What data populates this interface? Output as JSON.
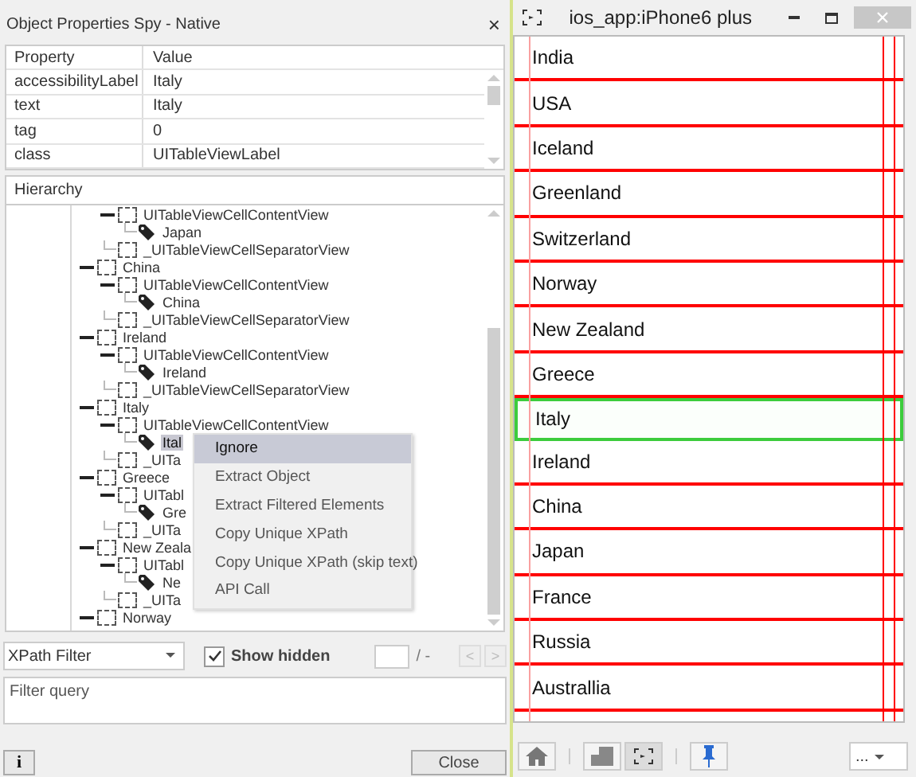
{
  "spy": {
    "title": "Object Properties Spy - Native",
    "close": "×",
    "properties": {
      "columns": [
        "Property",
        "Value"
      ],
      "rows": [
        {
          "name": "accessibilityLabel",
          "value": "Italy"
        },
        {
          "name": "text",
          "value": "Italy"
        },
        {
          "name": "tag",
          "value": "0"
        },
        {
          "name": "class",
          "value": "UITableViewLabel"
        }
      ]
    },
    "hierarchy": {
      "title": "Hierarchy",
      "items": [
        {
          "children": [
            {
              "kind": "view",
              "label": "UITableViewCellContentView",
              "expanded": true,
              "selected": false,
              "children": [
                {
                  "kind": "label",
                  "label": "Japan",
                  "selected": false
                }
              ]
            },
            {
              "kind": "view",
              "label": "_UITableViewCellSeparatorView",
              "selected": false
            }
          ]
        },
        {
          "kind": "view",
          "label": "China",
          "expanded": true,
          "selected": false,
          "children": [
            {
              "kind": "view",
              "label": "UITableViewCellContentView",
              "expanded": true,
              "selected": false,
              "children": [
                {
                  "kind": "label",
                  "label": "China",
                  "selected": false
                }
              ]
            },
            {
              "kind": "view",
              "label": "_UITableViewCellSeparatorView",
              "selected": false
            }
          ]
        },
        {
          "kind": "view",
          "label": "Ireland",
          "expanded": true,
          "selected": false,
          "children": [
            {
              "kind": "view",
              "label": "UITableViewCellContentView",
              "expanded": true,
              "selected": false,
              "children": [
                {
                  "kind": "label",
                  "label": "Ireland",
                  "selected": false
                }
              ]
            },
            {
              "kind": "view",
              "label": "_UITableViewCellSeparatorView",
              "selected": false
            }
          ]
        },
        {
          "kind": "view",
          "label": "Italy",
          "expanded": true,
          "selected": false,
          "children": [
            {
              "kind": "view",
              "label": "UITableViewCellContentView",
              "expanded": true,
              "selected": false,
              "children": [
                {
                  "kind": "label",
                  "label": "Ital",
                  "selected": true
                }
              ]
            },
            {
              "kind": "view",
              "label": "_UITa",
              "selected": false
            }
          ]
        },
        {
          "kind": "view",
          "label": "Greece",
          "expanded": true,
          "selected": false,
          "children": [
            {
              "kind": "view",
              "label": "UITabl",
              "expanded": true,
              "selected": false,
              "children": [
                {
                  "kind": "label",
                  "label": "Gre",
                  "selected": false
                }
              ]
            },
            {
              "kind": "view",
              "label": "_UITa",
              "selected": false
            }
          ]
        },
        {
          "kind": "view",
          "label": "New Zeala",
          "expanded": true,
          "selected": false,
          "children": [
            {
              "kind": "view",
              "label": "UITabl",
              "expanded": true,
              "selected": false,
              "children": [
                {
                  "kind": "label",
                  "label": "Ne",
                  "selected": false
                }
              ]
            },
            {
              "kind": "view",
              "label": "_UITa",
              "selected": false
            }
          ]
        },
        {
          "kind": "view",
          "label": "Norway",
          "expanded": true,
          "selected": false
        }
      ]
    },
    "context_menu": [
      {
        "label": "Ignore",
        "selected": true
      },
      {
        "label": "Extract Object",
        "selected": false
      },
      {
        "label": "Extract Filtered Elements",
        "selected": false
      },
      {
        "label": "Copy Unique XPath",
        "selected": false
      },
      {
        "label": "Copy Unique XPath (skip text)",
        "selected": false
      },
      {
        "label": "API Call",
        "selected": false
      }
    ],
    "filter": {
      "mode": "XPath Filter",
      "show_hidden": {
        "label": "Show hidden",
        "checked": true
      },
      "counter": "/ -",
      "prev": "<",
      "next": ">",
      "nav_disabled": true,
      "query_placeholder": "Filter query"
    },
    "info_button": "i",
    "close_button": "Close"
  },
  "device": {
    "title": "ios_app:iPhone6 plus",
    "rows": [
      {
        "label": "India",
        "selected": false
      },
      {
        "label": "USA",
        "selected": false
      },
      {
        "label": "Iceland",
        "selected": false
      },
      {
        "label": "Greenland",
        "selected": false
      },
      {
        "label": "Switzerland",
        "selected": false
      },
      {
        "label": "Norway",
        "selected": false
      },
      {
        "label": "New Zealand",
        "selected": false
      },
      {
        "label": "Greece",
        "selected": false
      },
      {
        "label": "Italy",
        "selected": true
      },
      {
        "label": "Ireland",
        "selected": false
      },
      {
        "label": "China",
        "selected": false
      },
      {
        "label": "Japan",
        "selected": false
      },
      {
        "label": "France",
        "selected": false
      },
      {
        "label": "Russia",
        "selected": false
      },
      {
        "label": "Australlia",
        "selected": false
      }
    ],
    "toolbar": [
      {
        "selected": false
      },
      {
        "selected": false
      },
      {
        "selected": true
      },
      {
        "selected": false
      }
    ],
    "more": "..."
  }
}
